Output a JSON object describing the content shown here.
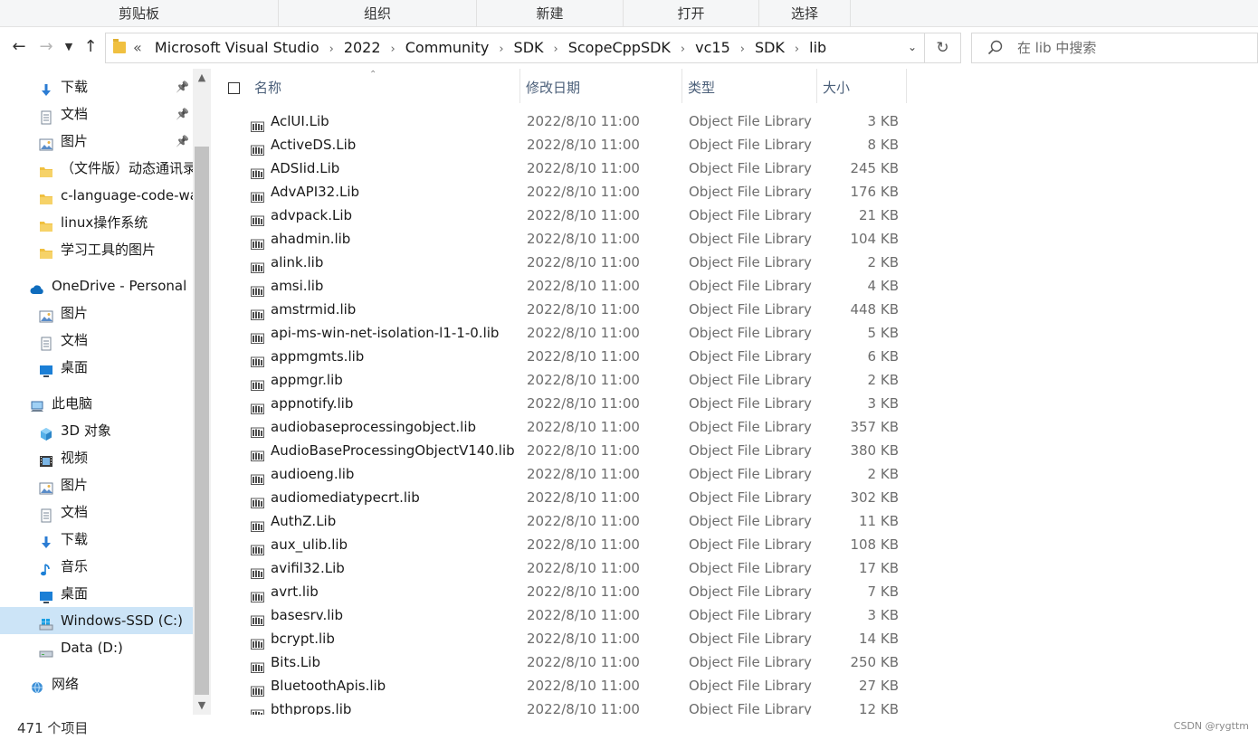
{
  "ribbon": [
    "剪贴板",
    "组织",
    "新建",
    "打开",
    "选择"
  ],
  "address": {
    "lead": "«",
    "crumbs": [
      "Microsoft Visual Studio",
      "2022",
      "Community",
      "SDK",
      "ScopeCppSDK",
      "vc15",
      "SDK",
      "lib"
    ]
  },
  "search": {
    "placeholder": "在 lib 中搜索"
  },
  "nav": [
    {
      "label": "下载",
      "icon": "download-icon",
      "indent": 2,
      "pinned": true
    },
    {
      "label": "文档",
      "icon": "document-icon",
      "indent": 2,
      "pinned": true
    },
    {
      "label": "图片",
      "icon": "picture-icon",
      "indent": 2,
      "pinned": true
    },
    {
      "label": "（文件版）动态通讯录",
      "icon": "folder-icon",
      "indent": 2,
      "pinned": false
    },
    {
      "label": "c-language-code-warehouse",
      "icon": "folder-icon",
      "indent": 2,
      "pinned": false
    },
    {
      "label": "linux操作系统",
      "icon": "folder-icon",
      "indent": 2,
      "pinned": false
    },
    {
      "label": "学习工具的图片",
      "icon": "folder-icon",
      "indent": 2,
      "pinned": false
    },
    {
      "label": "",
      "icon": "",
      "indent": 0,
      "spacer": true
    },
    {
      "label": "OneDrive - Personal",
      "icon": "cloud-icon",
      "indent": 1,
      "pinned": false
    },
    {
      "label": "图片",
      "icon": "picture-icon",
      "indent": 2,
      "pinned": false
    },
    {
      "label": "文档",
      "icon": "document-icon",
      "indent": 2,
      "pinned": false
    },
    {
      "label": "桌面",
      "icon": "desktop-icon",
      "indent": 2,
      "pinned": false
    },
    {
      "label": "",
      "icon": "",
      "indent": 0,
      "spacer": true
    },
    {
      "label": "此电脑",
      "icon": "computer-icon",
      "indent": 1,
      "pinned": false
    },
    {
      "label": "3D 对象",
      "icon": "cube-3d-icon",
      "indent": 2,
      "pinned": false
    },
    {
      "label": "视频",
      "icon": "video-icon",
      "indent": 2,
      "pinned": false
    },
    {
      "label": "图片",
      "icon": "picture-icon",
      "indent": 2,
      "pinned": false
    },
    {
      "label": "文档",
      "icon": "document-icon",
      "indent": 2,
      "pinned": false
    },
    {
      "label": "下载",
      "icon": "download-icon",
      "indent": 2,
      "pinned": false
    },
    {
      "label": "音乐",
      "icon": "music-icon",
      "indent": 2,
      "pinned": false
    },
    {
      "label": "桌面",
      "icon": "desktop-icon",
      "indent": 2,
      "pinned": false
    },
    {
      "label": "Windows-SSD (C:)",
      "icon": "windows-drive-icon",
      "indent": 2,
      "pinned": false,
      "selected": true
    },
    {
      "label": "Data (D:)",
      "icon": "drive-icon",
      "indent": 2,
      "pinned": false
    },
    {
      "label": "",
      "icon": "",
      "indent": 0,
      "spacer": true
    },
    {
      "label": "网络",
      "icon": "network-icon",
      "indent": 1,
      "pinned": false
    }
  ],
  "columns": {
    "name": "名称",
    "date": "修改日期",
    "type": "类型",
    "size": "大小"
  },
  "files": [
    {
      "name": "AclUI.Lib",
      "date": "2022/8/10 11:00",
      "type": "Object File Library",
      "size": "3 KB"
    },
    {
      "name": "ActiveDS.Lib",
      "date": "2022/8/10 11:00",
      "type": "Object File Library",
      "size": "8 KB"
    },
    {
      "name": "ADSIid.Lib",
      "date": "2022/8/10 11:00",
      "type": "Object File Library",
      "size": "245 KB"
    },
    {
      "name": "AdvAPI32.Lib",
      "date": "2022/8/10 11:00",
      "type": "Object File Library",
      "size": "176 KB"
    },
    {
      "name": "advpack.Lib",
      "date": "2022/8/10 11:00",
      "type": "Object File Library",
      "size": "21 KB"
    },
    {
      "name": "ahadmin.lib",
      "date": "2022/8/10 11:00",
      "type": "Object File Library",
      "size": "104 KB"
    },
    {
      "name": "alink.lib",
      "date": "2022/8/10 11:00",
      "type": "Object File Library",
      "size": "2 KB"
    },
    {
      "name": "amsi.lib",
      "date": "2022/8/10 11:00",
      "type": "Object File Library",
      "size": "4 KB"
    },
    {
      "name": "amstrmid.lib",
      "date": "2022/8/10 11:00",
      "type": "Object File Library",
      "size": "448 KB"
    },
    {
      "name": "api-ms-win-net-isolation-l1-1-0.lib",
      "date": "2022/8/10 11:00",
      "type": "Object File Library",
      "size": "5 KB"
    },
    {
      "name": "appmgmts.lib",
      "date": "2022/8/10 11:00",
      "type": "Object File Library",
      "size": "6 KB"
    },
    {
      "name": "appmgr.lib",
      "date": "2022/8/10 11:00",
      "type": "Object File Library",
      "size": "2 KB"
    },
    {
      "name": "appnotify.lib",
      "date": "2022/8/10 11:00",
      "type": "Object File Library",
      "size": "3 KB"
    },
    {
      "name": "audiobaseprocessingobject.lib",
      "date": "2022/8/10 11:00",
      "type": "Object File Library",
      "size": "357 KB"
    },
    {
      "name": "AudioBaseProcessingObjectV140.lib",
      "date": "2022/8/10 11:00",
      "type": "Object File Library",
      "size": "380 KB"
    },
    {
      "name": "audioeng.lib",
      "date": "2022/8/10 11:00",
      "type": "Object File Library",
      "size": "2 KB"
    },
    {
      "name": "audiomediatypecrt.lib",
      "date": "2022/8/10 11:00",
      "type": "Object File Library",
      "size": "302 KB"
    },
    {
      "name": "AuthZ.Lib",
      "date": "2022/8/10 11:00",
      "type": "Object File Library",
      "size": "11 KB"
    },
    {
      "name": "aux_ulib.lib",
      "date": "2022/8/10 11:00",
      "type": "Object File Library",
      "size": "108 KB"
    },
    {
      "name": "avifil32.Lib",
      "date": "2022/8/10 11:00",
      "type": "Object File Library",
      "size": "17 KB"
    },
    {
      "name": "avrt.lib",
      "date": "2022/8/10 11:00",
      "type": "Object File Library",
      "size": "7 KB"
    },
    {
      "name": "basesrv.lib",
      "date": "2022/8/10 11:00",
      "type": "Object File Library",
      "size": "3 KB"
    },
    {
      "name": "bcrypt.lib",
      "date": "2022/8/10 11:00",
      "type": "Object File Library",
      "size": "14 KB"
    },
    {
      "name": "Bits.Lib",
      "date": "2022/8/10 11:00",
      "type": "Object File Library",
      "size": "250 KB"
    },
    {
      "name": "BluetoothApis.lib",
      "date": "2022/8/10 11:00",
      "type": "Object File Library",
      "size": "27 KB"
    },
    {
      "name": "bthprops.lib",
      "date": "2022/8/10 11:00",
      "type": "Object File Library",
      "size": "12 KB"
    }
  ],
  "status": {
    "count": "471 个项目",
    "watermark": "CSDN @rygttm"
  },
  "colors": {
    "accent": "#0078d4",
    "selection": "#cce4f7",
    "folder": "#f0c040"
  }
}
